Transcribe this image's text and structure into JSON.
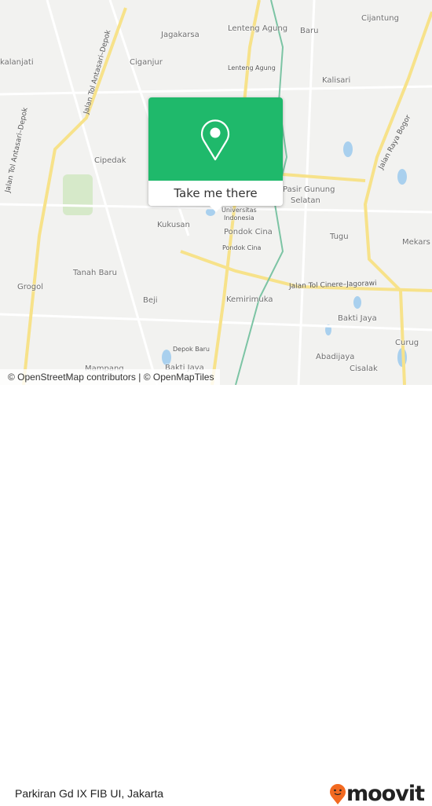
{
  "map": {
    "labels": {
      "cijantung": "Cijantung",
      "lenteng_agung": "Lenteng Agung",
      "baru": "Baru",
      "jagakarsa": "Jagakarsa",
      "kalanjati": "kalanjati",
      "lenteng_agung_small": "Lenteng Agung",
      "ciganjur": "Ciganjur",
      "kalisari": "Kalisari",
      "cipedak": "Cipedak",
      "kukusan": "Kukusan",
      "universitas": "Universitas",
      "indonesia": "Indonesia",
      "pondok_cina": "Pondok Cina",
      "pondok_cina_small": "Pondok Cina",
      "pasir_gunung": "Pasir Gunung",
      "selatan": "Selatan",
      "tugu": "Tugu",
      "mekars": "Mekars",
      "tanah_baru": "Tanah Baru",
      "grogol": "Grogol",
      "beji": "Beji",
      "kemirimuka": "Kemirimuka",
      "bakti_jaya": "Bakti Jaya",
      "abadijaya": "Abadijaya",
      "curug": "Curug",
      "cisalak": "Cisalak",
      "depok_baru": "Depok Baru",
      "bakti_jaya_2": "Bakti Jaya",
      "mampang": "Mampang"
    },
    "roads": {
      "tol_cinere": "Jalan Tol Cinere–Jagorawi",
      "antasari_1": "Jalan Tol Antasari–Depok",
      "antasari_2": "Jalan Tol Antasari–Depok",
      "raya_bogor": "Jalan Raya Bogor"
    },
    "attribution": "© OpenStreetMap contributors | © OpenMapTiles"
  },
  "popup": {
    "icon": "location-pin-icon",
    "button_label": "Take me there",
    "color": "#1fb96b"
  },
  "footer": {
    "place_name": "Parkiran Gd IX FIB UI, Jakarta",
    "brand": "moovit",
    "brand_color": "#f26a21"
  }
}
